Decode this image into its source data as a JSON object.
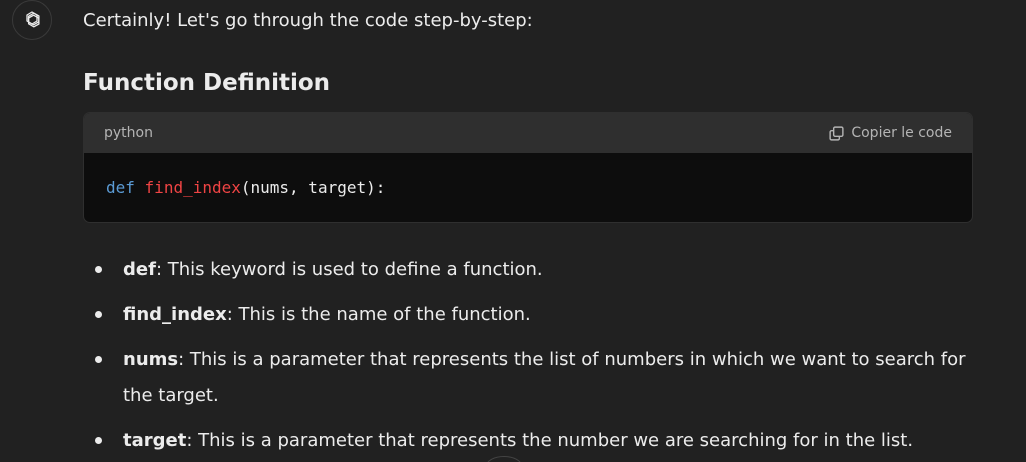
{
  "assistant": {
    "avatar_icon": "chatgpt-logo-icon"
  },
  "message": {
    "intro": "Certainly! Let's go through the code step-by-step:",
    "section_heading": "Function Definition",
    "code_block": {
      "language": "python",
      "copy_label": "Copier le code",
      "copy_icon": "copy-icon",
      "code": {
        "keyword": "def",
        "function_name": "find_index",
        "rest": "(nums, target):"
      }
    },
    "bullets": [
      {
        "term": "def",
        "text": ": This keyword is used to define a function."
      },
      {
        "term": "find_index",
        "text": ": This is the name of the function."
      },
      {
        "term": "nums",
        "text": ": This is a parameter that represents the list of numbers in which we want to search for the target."
      },
      {
        "term": "target",
        "text": ": This is a parameter that represents the number we are searching for in the list."
      }
    ]
  },
  "colors": {
    "background": "#212121",
    "code_header": "#2f2f2f",
    "code_body": "#0d0d0d",
    "keyword": "#5b9bd5",
    "function_name": "#ef4444",
    "text": "#ececec"
  }
}
